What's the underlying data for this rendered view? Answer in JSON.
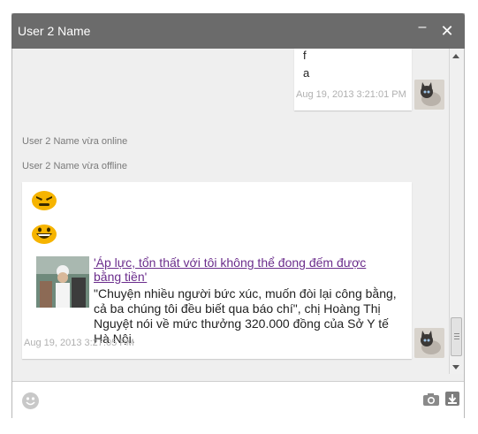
{
  "window": {
    "title": "User 2 Name",
    "minimize_glyph": "–",
    "close_glyph": "✕"
  },
  "messages": {
    "outgoing": {
      "lines": [
        "f",
        "a"
      ],
      "timestamp": "Aug 19, 2013 3:21:01 PM"
    },
    "status": [
      "User 2 Name vừa online",
      "User 2 Name vừa offline"
    ],
    "incoming": {
      "emojis": [
        "angry-face-emoji",
        "grinning-face-emoji"
      ],
      "link_title": "'Áp lực, tổn thất với tôi không thể đong đếm được bằng tiền'",
      "snippet": "\"Chuyện nhiều người bức xúc, muốn đòi lại công bằng, cả ba chúng tôi đều biết qua báo chí\", chị Hoàng Thị Nguyệt nói về mức thưởng 320.000 đồng của Sở Y tế Hà Nội.",
      "timestamp": "Aug 19, 2013 3:27:05 PM"
    }
  },
  "composer": {
    "icons": [
      "smiley-icon",
      "camera-icon",
      "attach-icon"
    ]
  },
  "colors": {
    "titlebar": "#6b6b6b",
    "emoji": "#f6b400",
    "link": "#6b2d8c"
  }
}
